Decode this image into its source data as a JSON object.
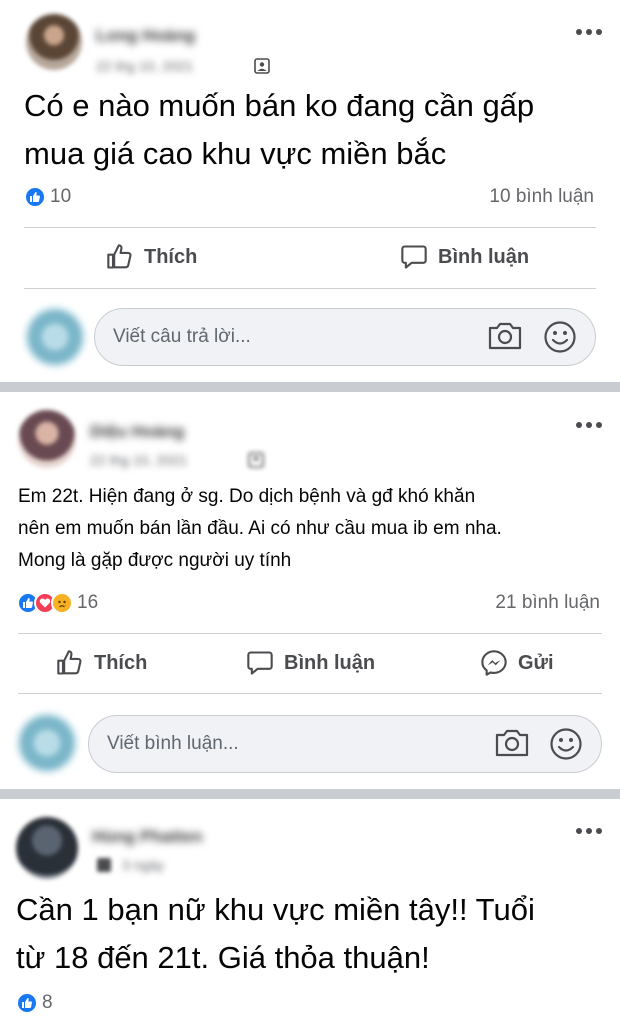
{
  "posts": [
    {
      "author": "Long Hoàng",
      "time": "22 thg 10, 2021",
      "text_lines": [
        "Có e nào muốn bán ko đang cần gấp",
        "mua giá cao khu vực miền bắc"
      ],
      "reaction_count": "10",
      "comment_count": "10 bình luận",
      "actions": {
        "like": "Thích",
        "comment": "Bình luận"
      },
      "comment_placeholder": "Viết câu trả lời..."
    },
    {
      "author": "Diệu Hoàng",
      "time": "22 thg 10, 2021",
      "text_lines": [
        "Em 22t. Hiện đang ở sg. Do dịch bệnh và gđ khó khăn",
        "nên em muốn bán lần đầu. Ai có như cầu mua ib em nha.",
        "Mong là gặp được người uy tính"
      ],
      "reaction_count": "16",
      "comment_count": "21 bình luận",
      "actions": {
        "like": "Thích",
        "comment": "Bình luận",
        "send": "Gửi"
      },
      "comment_placeholder": "Viết bình luận..."
    },
    {
      "author": "Hùng Phatten",
      "time": "3 ngày",
      "text_lines": [
        "Cần 1 bạn nữ khu vực miền tây!! Tuổi",
        "từ 18 đến 21t.  Giá thỏa thuận!"
      ],
      "reaction_count": "8"
    }
  ],
  "icons": {
    "more": "more-horizontal-icon",
    "like": "thumbs-up-icon",
    "comment": "speech-bubble-icon",
    "send": "messenger-icon",
    "camera": "camera-icon",
    "emoji": "smile-icon",
    "privacy": "group-privacy-icon"
  },
  "colors": {
    "like_blue": "#1877f2",
    "love_red": "#f33e58",
    "sad_yellow": "#f7b125",
    "separator": "#c9ccd1",
    "muted_text": "#65676b"
  }
}
